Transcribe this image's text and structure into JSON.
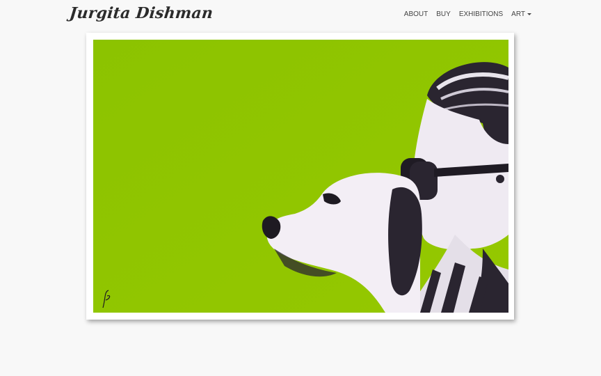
{
  "site": {
    "brand": "Jurgita Dishman"
  },
  "nav": {
    "items": [
      {
        "label": "ABOUT"
      },
      {
        "label": "BUY"
      },
      {
        "label": "EXHIBITIONS"
      },
      {
        "label": "ART",
        "dropdown": true
      }
    ]
  },
  "artwork": {
    "background_color": "#8fc400",
    "icon": "painting-woman-with-dog"
  }
}
